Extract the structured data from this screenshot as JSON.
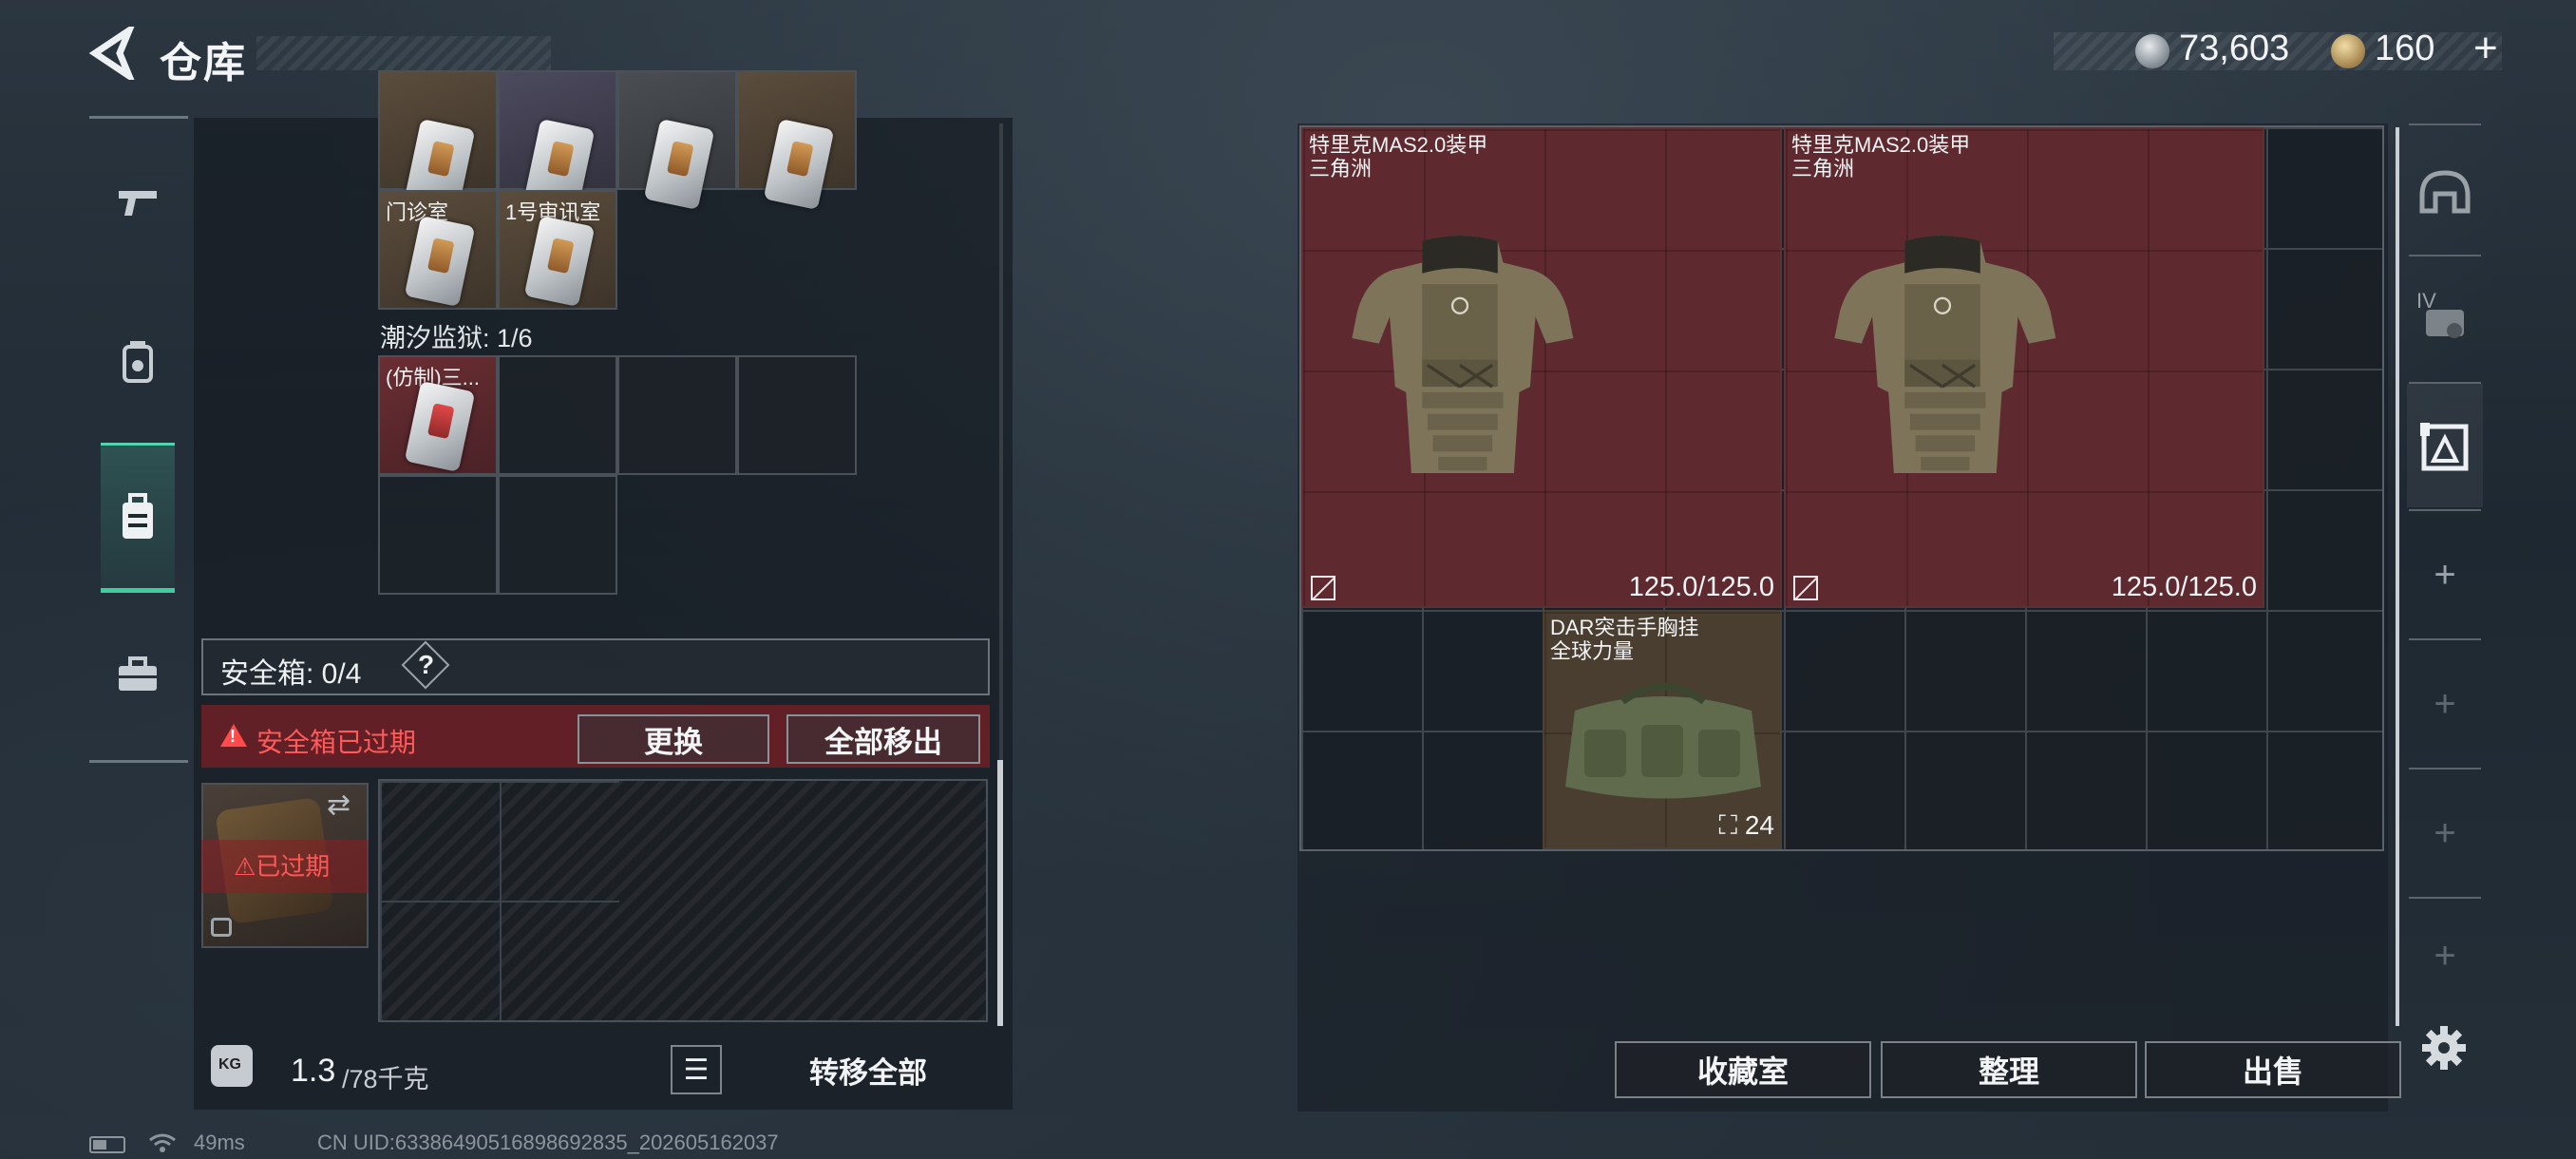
{
  "header": {
    "title": "仓库",
    "currency": {
      "silver": "73,603",
      "gold": "160",
      "plus": "+"
    }
  },
  "left_nav": {
    "items": [
      {
        "name": "weapons",
        "icon": "gun-icon"
      },
      {
        "name": "gear",
        "icon": "vest-icon"
      },
      {
        "name": "storage",
        "icon": "backpack-icon",
        "active": true
      },
      {
        "name": "toolbox",
        "icon": "briefcase-icon"
      }
    ]
  },
  "inventory": {
    "key_rows": [
      {
        "labels": [
          "",
          "",
          "",
          ""
        ]
      },
      {
        "labels": [
          "门诊室",
          "1号审讯室"
        ]
      }
    ],
    "prison_section": {
      "label": "潮汐监狱: 1/6",
      "item_label": "(仿制)三..."
    }
  },
  "safe_box": {
    "label": "安全箱: 0/4",
    "help": "?",
    "expired_text": "安全箱已过期",
    "warn_mark": "!",
    "replace_btn": "更换",
    "move_all_btn": "全部移出",
    "case_expired": "⚠已过期",
    "swap_glyph": "⇄"
  },
  "footer": {
    "weight_icon": "KG",
    "weight_current": "1.3",
    "weight_max": "/78千克",
    "list_glyph": "☰",
    "transfer_all": "转移全部",
    "ping": "49ms",
    "uid": "CN UID:633864905168986​92835_202605162037"
  },
  "stash": {
    "items": [
      {
        "name": "特里克MAS2.0装甲",
        "source": "三角洲",
        "durability": "125.0/125.0"
      },
      {
        "name": "特里克MAS2.0装甲",
        "source": "三角洲",
        "durability": "125.0/125.0"
      },
      {
        "name": "DAR突击手胸挂",
        "source": "全球力量",
        "capacity": "24"
      }
    ]
  },
  "right_nav": {
    "items": [
      {
        "icon": "helmet-icon"
      },
      {
        "icon": "armor-level-icon",
        "text": "IV"
      },
      {
        "icon": "chest-rig-icon"
      },
      {
        "icon": "plus-icon",
        "text": "+"
      },
      {
        "icon": "plus-icon",
        "text": "+"
      },
      {
        "icon": "plus-icon",
        "text": "+"
      },
      {
        "icon": "plus-icon",
        "text": "+"
      }
    ]
  },
  "bottom_buttons": {
    "collection": "收藏室",
    "organize": "整理",
    "sell": "出售"
  },
  "colors": {
    "accent_active": "#3ccf9c",
    "expired_red": "#ff5a5a",
    "armor_bg": "#5e2a30"
  }
}
